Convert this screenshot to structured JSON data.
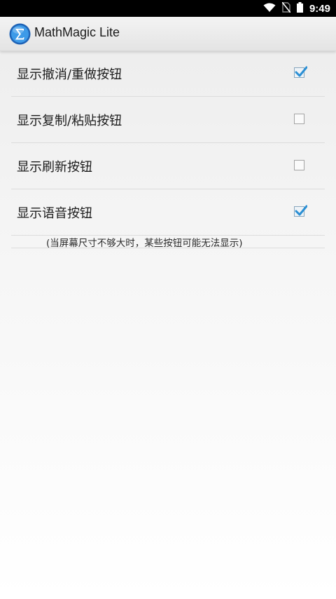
{
  "status_bar": {
    "time": "9:49",
    "icons": [
      "wifi-icon",
      "no-sim-icon",
      "battery-icon"
    ]
  },
  "app_bar": {
    "title": "MathMagic Lite",
    "logo_icon": "sigma-logo-icon"
  },
  "preferences": [
    {
      "label": "显示撤消/重做按钮",
      "checked": true
    },
    {
      "label": "显示复制/粘贴按钮",
      "checked": false
    },
    {
      "label": "显示刷新按钮",
      "checked": false
    },
    {
      "label": "显示语音按钮",
      "checked": true
    }
  ],
  "hint": "(当屏幕尺寸不够大时，某些按钮可能无法显示)",
  "colors": {
    "accent": "#2a8fd4",
    "status_bar_bg": "#000000",
    "app_bar_bg": "#e8e8e8"
  }
}
